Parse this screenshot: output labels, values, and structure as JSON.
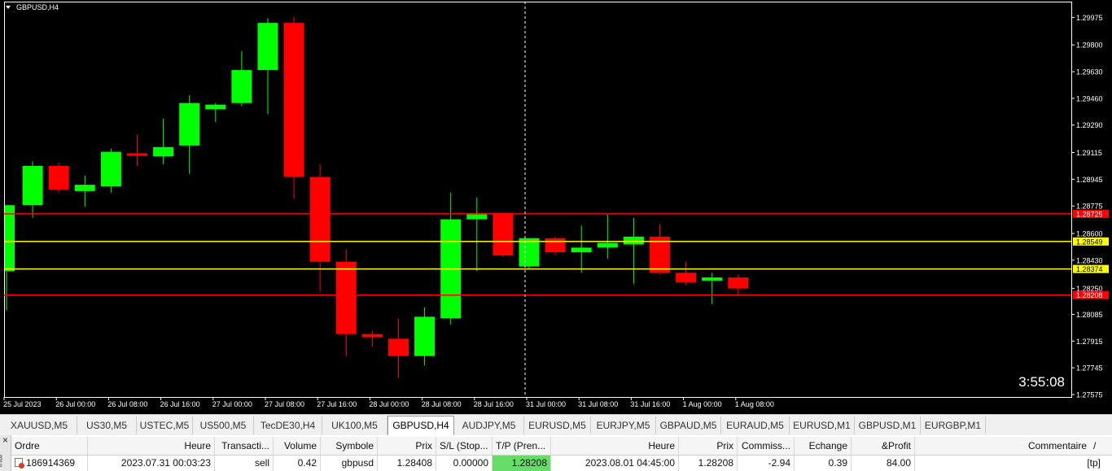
{
  "chart": {
    "title": "GBPUSD,H4",
    "countdown": "3:55:08",
    "colors": {
      "background": "#000000",
      "bull": "#00ff00",
      "bear": "#ff0000",
      "axis": "#ffffff",
      "yellow_line": "#ffff00",
      "red_line": "#ff0000"
    },
    "price_range": [
      1.27575,
      1.3006
    ],
    "price_ticks": [
      "1.29975",
      "1.29800",
      "1.29630",
      "1.29460",
      "1.29290",
      "1.29115",
      "1.28945",
      "1.28775",
      "1.28600",
      "1.28430",
      "1.28250",
      "1.28085",
      "1.27915",
      "1.27745",
      "1.27575"
    ],
    "time_labels": [
      "25 Jul 2023",
      "26 Jul 00:00",
      "26 Jul 08:00",
      "26 Jul 16:00",
      "27 Jul 00:00",
      "27 Jul 08:00",
      "27 Jul 16:00",
      "28 Jul 00:00",
      "28 Jul 08:00",
      "28 Jul 16:00",
      "31 Jul 00:00",
      "31 Jul 08:00",
      "31 Jul 16:00",
      "1 Aug 00:00",
      "1 Aug 08:00"
    ],
    "hlines": [
      {
        "price": 1.28725,
        "color": "#ff0000",
        "label": "1.28725"
      },
      {
        "price": 1.28549,
        "color": "#ffff00",
        "label": "1.28549"
      },
      {
        "price": 1.28374,
        "color": "#ffff00",
        "label": "1.28374"
      },
      {
        "price": 1.28208,
        "color": "#ff0000",
        "label": "1.28208"
      }
    ],
    "candles": [
      {
        "o": 1.2836,
        "h": 1.2878,
        "l": 1.2811,
        "c": 1.2878
      },
      {
        "o": 1.2878,
        "h": 1.2906,
        "l": 1.287,
        "c": 1.2903
      },
      {
        "o": 1.2903,
        "h": 1.2905,
        "l": 1.2886,
        "c": 1.2888
      },
      {
        "o": 1.2887,
        "h": 1.2897,
        "l": 1.2877,
        "c": 1.2891
      },
      {
        "o": 1.289,
        "h": 1.2914,
        "l": 1.2886,
        "c": 1.2912
      },
      {
        "o": 1.2911,
        "h": 1.2923,
        "l": 1.2903,
        "c": 1.291
      },
      {
        "o": 1.2909,
        "h": 1.2933,
        "l": 1.2904,
        "c": 1.2915
      },
      {
        "o": 1.2916,
        "h": 1.2948,
        "l": 1.2898,
        "c": 1.2943
      },
      {
        "o": 1.2939,
        "h": 1.2943,
        "l": 1.2931,
        "c": 1.2942
      },
      {
        "o": 1.2943,
        "h": 1.2976,
        "l": 1.2941,
        "c": 1.2964
      },
      {
        "o": 1.2964,
        "h": 1.2997,
        "l": 1.2936,
        "c": 1.2994
      },
      {
        "o": 1.2994,
        "h": 1.2998,
        "l": 1.2882,
        "c": 1.2896
      },
      {
        "o": 1.2896,
        "h": 1.2904,
        "l": 1.2823,
        "c": 1.2842
      },
      {
        "o": 1.2842,
        "h": 1.285,
        "l": 1.2782,
        "c": 1.2796
      },
      {
        "o": 1.2796,
        "h": 1.2798,
        "l": 1.2788,
        "c": 1.2794
      },
      {
        "o": 1.2793,
        "h": 1.2806,
        "l": 1.2768,
        "c": 1.2782
      },
      {
        "o": 1.2782,
        "h": 1.2813,
        "l": 1.2776,
        "c": 1.2807
      },
      {
        "o": 1.2806,
        "h": 1.2886,
        "l": 1.2802,
        "c": 1.2869
      },
      {
        "o": 1.2869,
        "h": 1.2883,
        "l": 1.2836,
        "c": 1.2873
      },
      {
        "o": 1.2873,
        "h": 1.2873,
        "l": 1.2845,
        "c": 1.2846
      },
      {
        "o": 1.2839,
        "h": 1.2857,
        "l": 1.2837,
        "c": 1.2857
      },
      {
        "o": 1.2857,
        "h": 1.2858,
        "l": 1.2846,
        "c": 1.2848
      },
      {
        "o": 1.2848,
        "h": 1.2865,
        "l": 1.2835,
        "c": 1.2851
      },
      {
        "o": 1.2851,
        "h": 1.2872,
        "l": 1.2844,
        "c": 1.2854
      },
      {
        "o": 1.2853,
        "h": 1.287,
        "l": 1.2828,
        "c": 1.2858
      },
      {
        "o": 1.2858,
        "h": 1.2866,
        "l": 1.2834,
        "c": 1.2835
      },
      {
        "o": 1.2835,
        "h": 1.2842,
        "l": 1.2827,
        "c": 1.2829
      },
      {
        "o": 1.283,
        "h": 1.2835,
        "l": 1.2815,
        "c": 1.2832
      },
      {
        "o": 1.2832,
        "h": 1.2834,
        "l": 1.282,
        "c": 1.2825
      }
    ]
  },
  "symbol_tabs": [
    {
      "label": "XAUUSD,M5",
      "active": false
    },
    {
      "label": "US30,M5",
      "active": false
    },
    {
      "label": "USTEC,M5",
      "active": false
    },
    {
      "label": "US500,M5",
      "active": false
    },
    {
      "label": "TecDE30,H4",
      "active": false
    },
    {
      "label": "UK100,M5",
      "active": false
    },
    {
      "label": "GBPUSD,H4",
      "active": true
    },
    {
      "label": "AUDJPY,M5",
      "active": false
    },
    {
      "label": "EURUSD,M5",
      "active": false
    },
    {
      "label": "EURJPY,M5",
      "active": false
    },
    {
      "label": "GBPAUD,M5",
      "active": false
    },
    {
      "label": "EURAUD,M5",
      "active": false
    },
    {
      "label": "EURUSD,M1",
      "active": false
    },
    {
      "label": "GBPUSD,M1",
      "active": false
    },
    {
      "label": "EURGBP,M1",
      "active": false
    }
  ],
  "terminal": {
    "close": "×",
    "side_label": "inal",
    "columns": {
      "ordre": "Ordre",
      "heure": "Heure",
      "transaction": "Transacti...",
      "volume": "Volume",
      "symbole": "Symbole",
      "prix": "Prix",
      "sl": "S/L (Stop...",
      "tp": "T/P (Pren...",
      "heure2": "Heure",
      "prix2": "Prix",
      "commission": "Commiss...",
      "echange": "Echange",
      "profit": "&Profit",
      "commentaire": "Commentaire",
      "slash": "/"
    },
    "row": {
      "ordre": "186914369",
      "heure": "2023.07.31 00:03:23",
      "transaction": "sell",
      "volume": "0.42",
      "symbole": "gbpusd",
      "prix": "1.28408",
      "sl": "0.00000",
      "tp": "1.28208",
      "heure2": "2023.08.01 04:45:00",
      "prix2": "1.28208",
      "commission": "-2.94",
      "echange": "0.39",
      "profit": "84.00",
      "commentaire": "[tp]"
    }
  }
}
